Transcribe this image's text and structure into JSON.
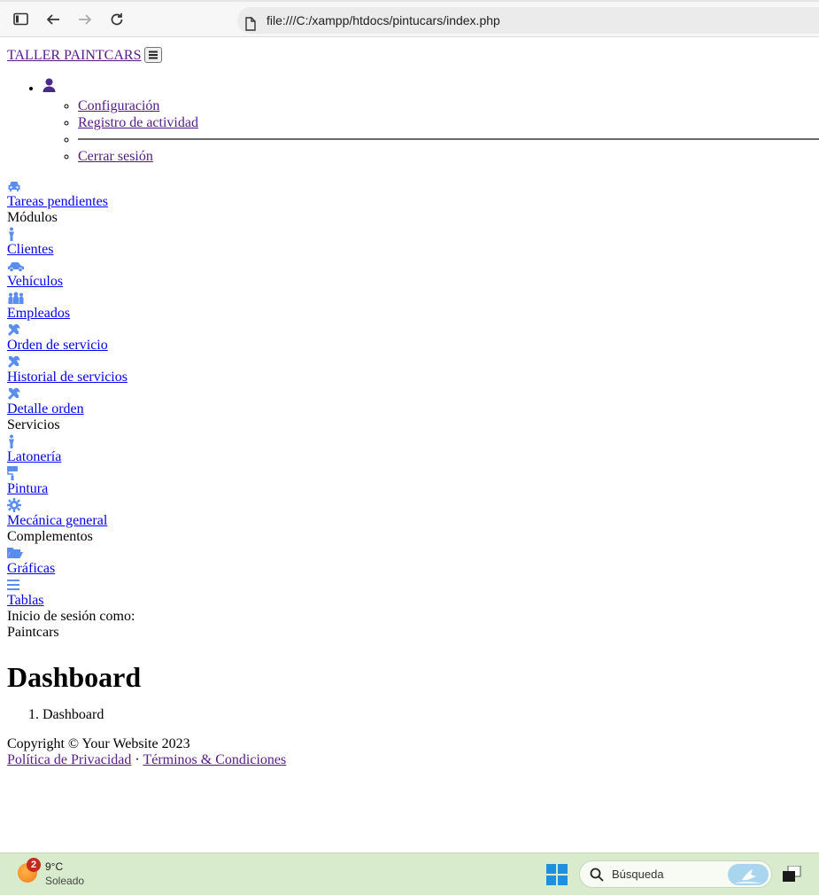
{
  "browser": {
    "url": "file:///C:/xampp/htdocs/pintucars/index.php"
  },
  "navbar": {
    "brand": "TALLER PAINTCARS",
    "user_menu": [
      "Configuración",
      "Registro de actividad",
      "Cerrar sesión"
    ]
  },
  "sidebar": {
    "core": {
      "label": "Tareas pendientes",
      "icon": "car-icon"
    },
    "modules_heading": "Módulos",
    "modules": [
      {
        "label": "Clientes",
        "icon": "person-icon"
      },
      {
        "label": "Vehículos",
        "icon": "car-side-icon"
      },
      {
        "label": "Empleados",
        "icon": "people-group-icon"
      },
      {
        "label": "Orden de servicio",
        "icon": "tools-icon"
      },
      {
        "label": "Historial de servicios",
        "icon": "tools-icon"
      },
      {
        "label": "Detalle orden",
        "icon": "tools-icon"
      }
    ],
    "services_heading": "Servicios",
    "services": [
      {
        "label": "Latonería",
        "icon": "person-icon"
      },
      {
        "label": "Pintura",
        "icon": "paint-roller-icon"
      },
      {
        "label": "Mecánica general",
        "icon": "gear-icon"
      }
    ],
    "addons_heading": "Complementos",
    "addons": [
      {
        "label": "Gráficas",
        "icon": "folder-open-icon"
      },
      {
        "label": "Tablas",
        "icon": "bars-icon"
      }
    ],
    "login_label": "Inicio de sesión como:",
    "login_user": "Paintcars"
  },
  "main": {
    "title": "Dashboard",
    "breadcrumb": [
      "Dashboard"
    ]
  },
  "footer": {
    "copyright": "Copyright © Your Website 2023",
    "privacy": "Política de Privacidad",
    "separator": "·",
    "terms": "Términos & Condiciones"
  },
  "taskbar": {
    "weather_temp": "9°C",
    "weather_cond": "Soleado",
    "badge_count": "2",
    "search_placeholder": "Búsqueda"
  },
  "colors": {
    "link": "#0000ee",
    "visited": "#551a8b",
    "sidebar_icon": "#5b8def",
    "user_icon": "#4a2a87"
  }
}
